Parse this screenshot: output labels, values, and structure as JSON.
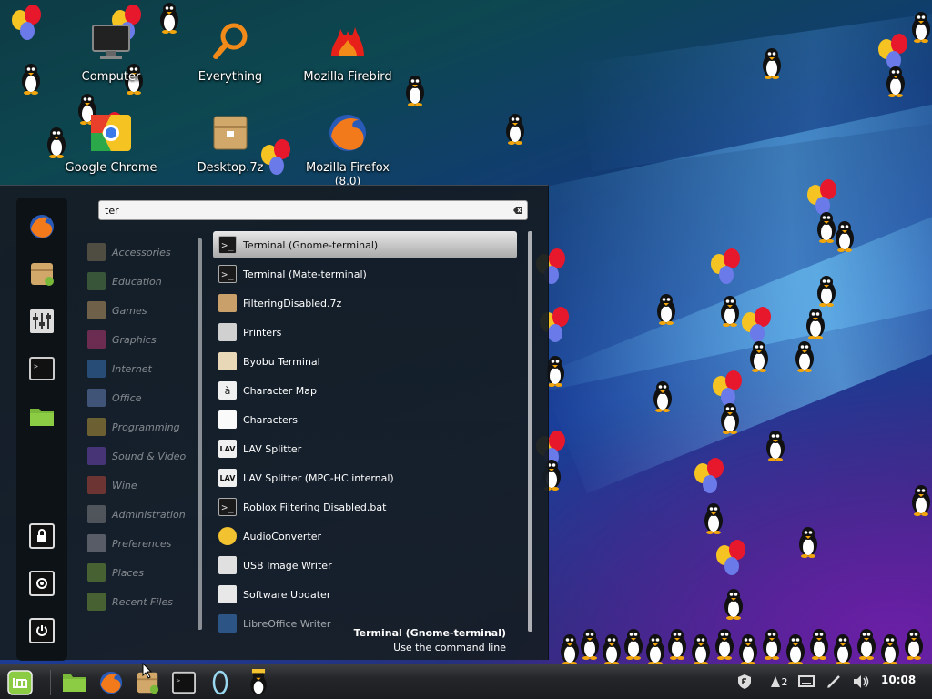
{
  "desktop": {
    "icons": [
      {
        "label": "Computer",
        "sublabel": ""
      },
      {
        "label": "Everything",
        "sublabel": ""
      },
      {
        "label": "Mozilla Firebird",
        "sublabel": ""
      },
      {
        "label": "Google Chrome",
        "sublabel": ""
      },
      {
        "label": "Desktop.7z",
        "sublabel": ""
      },
      {
        "label": "Mozilla Firefox",
        "sublabel": "(8.0)"
      }
    ]
  },
  "menu": {
    "search": {
      "value": "ter"
    },
    "favorites": [
      {
        "icon": "firefox-icon"
      },
      {
        "icon": "software-manager-icon"
      },
      {
        "icon": "settings-icon"
      },
      {
        "icon": "terminal-icon"
      },
      {
        "icon": "folder-icon"
      }
    ],
    "system": [
      {
        "icon": "lock-icon"
      },
      {
        "icon": "logout-icon"
      },
      {
        "icon": "power-icon"
      }
    ],
    "categories": [
      {
        "label": "Accessories",
        "color": "#8a7a5a"
      },
      {
        "label": "Education",
        "color": "#5c8a4a"
      },
      {
        "label": "Games",
        "color": "#c9a06a"
      },
      {
        "label": "Graphics",
        "color": "#c23a7a"
      },
      {
        "label": "Internet",
        "color": "#3a7ac2"
      },
      {
        "label": "Office",
        "color": "#6a8ac2"
      },
      {
        "label": "Programming",
        "color": "#c2a23a"
      },
      {
        "label": "Sound & Video",
        "color": "#7a4ac2"
      },
      {
        "label": "Wine",
        "color": "#c24a3a"
      },
      {
        "label": "Administration",
        "color": "#8a8a8a"
      },
      {
        "label": "Preferences",
        "color": "#9a9aa2"
      },
      {
        "label": "Places",
        "color": "#7aa23a"
      },
      {
        "label": "Recent Files",
        "color": "#7aa23a"
      }
    ],
    "results": [
      {
        "label": "Terminal (Gnome-terminal)",
        "icon": "terminal-icon",
        "glyph": ">_",
        "bg": "#1a1a1a"
      },
      {
        "label": "Terminal (Mate-terminal)",
        "icon": "terminal-icon",
        "glyph": ">_",
        "bg": "#1a1a1a"
      },
      {
        "label": "FilteringDisabled.7z",
        "icon": "archive-icon",
        "glyph": "",
        "bg": "#c9a06a"
      },
      {
        "label": "Printers",
        "icon": "printer-icon",
        "glyph": "",
        "bg": "#d0d0d0"
      },
      {
        "label": "Byobu Terminal",
        "icon": "byobu-icon",
        "glyph": "",
        "bg": "#e8d8b8"
      },
      {
        "label": "Character Map",
        "icon": "character-map-icon",
        "glyph": "à",
        "bg": "#f0f0f0"
      },
      {
        "label": "Characters",
        "icon": "characters-icon",
        "glyph": "",
        "bg": "#fafafa"
      },
      {
        "label": "LAV Splitter",
        "icon": "lav-icon",
        "glyph": "LAV",
        "bg": "#f0f0f0"
      },
      {
        "label": "LAV Splitter (MPC-HC internal)",
        "icon": "lav-icon",
        "glyph": "LAV",
        "bg": "#f0f0f0"
      },
      {
        "label": "Roblox Filtering Disabled.bat",
        "icon": "batch-file-icon",
        "glyph": ">_",
        "bg": "#1a1a1a"
      },
      {
        "label": "AudioConverter",
        "icon": "audio-converter-icon",
        "glyph": "",
        "bg": "#f2c230"
      },
      {
        "label": "USB Image Writer",
        "icon": "usb-writer-icon",
        "glyph": "",
        "bg": "#e0e0e0"
      },
      {
        "label": "Software Updater",
        "icon": "software-updater-icon",
        "glyph": "",
        "bg": "#e8e8e8"
      },
      {
        "label": "LibreOffice Writer",
        "icon": "writer-icon",
        "glyph": "",
        "bg": "#3a7ac2"
      }
    ],
    "tooltip": {
      "title": "Terminal (Gnome-terminal)",
      "desc": "Use the command line"
    }
  },
  "taskbar": {
    "items": [
      {
        "icon": "mint-menu-icon"
      },
      {
        "icon": "folder-icon"
      },
      {
        "icon": "firefox-icon"
      },
      {
        "icon": "software-manager-icon"
      },
      {
        "icon": "terminal-icon"
      },
      {
        "icon": "portal-icon"
      },
      {
        "icon": "penguin-app-icon"
      }
    ],
    "tray": {
      "shield_icon": "shield-icon",
      "network_count": "2",
      "clock": "10:08"
    }
  }
}
